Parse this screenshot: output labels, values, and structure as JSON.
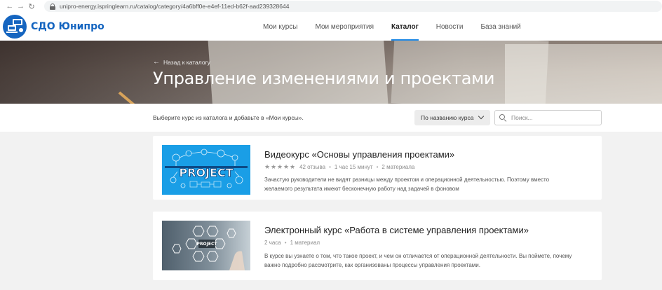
{
  "browser": {
    "url": "unipro-energy.ispringlearn.ru/catalog/category/4a6bff0e-e4ef-11ed-b62f-aad239328644"
  },
  "header": {
    "logo_text": "СДО Юнипро",
    "nav": [
      {
        "label": "Мои курсы"
      },
      {
        "label": "Мои мероприятия"
      },
      {
        "label": "Каталог"
      },
      {
        "label": "Новости"
      },
      {
        "label": "База знаний"
      }
    ],
    "active_nav": "Каталог"
  },
  "banner": {
    "back_label": "Назад к каталогу",
    "title": "Управление изменениями и проектами"
  },
  "toolbar": {
    "hint": "Выберите курс из каталога и добавьте в «Мои курсы».",
    "sort_label": "По названию курса",
    "search_placeholder": "Поиск..."
  },
  "courses": [
    {
      "title": "Видеокурс «Основы управления проектами»",
      "rating_stars": 5,
      "reviews": "42 отзыва",
      "duration": "1 час 15 минут",
      "materials": "2 материала",
      "description": "Зачастую руководители не видят разницы между проектом и операционной деятельностью. Поэтому вместо желаемого результата имеют бесконечную работу над задачей в фоновом",
      "thumb_text": "PROJECT"
    },
    {
      "title": "Электронный курс «Работа в системе управления проектами»",
      "duration": "2 часа",
      "materials": "1 материал",
      "description": "В курсе вы узнаете о том, что такое проект, и чем он отличается от операционной деятельности. Вы поймете, почему важно подробно рассмотрите, как организованы процессы управления проектами.",
      "thumb_text": "PROJECT"
    }
  ],
  "colors": {
    "accent": "#1e88e5",
    "logo": "#1565c0",
    "thumb1_bg": "#1a9ee6"
  }
}
